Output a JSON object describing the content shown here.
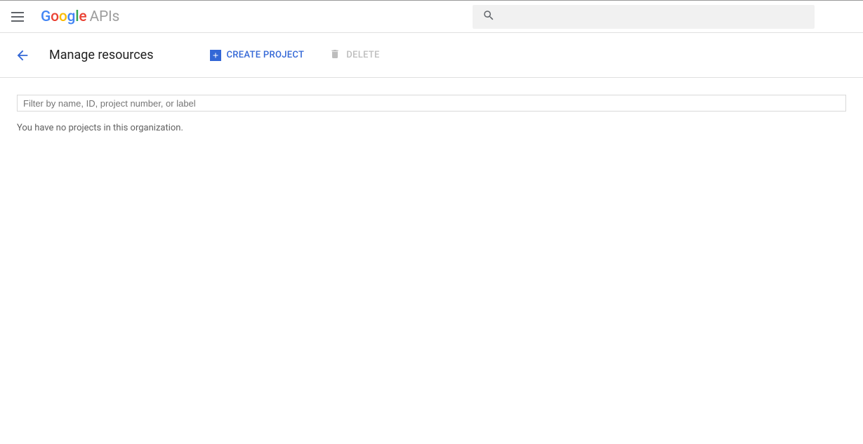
{
  "header": {
    "logo_suffix": "APIs",
    "search_placeholder": ""
  },
  "actionbar": {
    "title": "Manage resources",
    "create_label": "Create Project",
    "delete_label": "Delete"
  },
  "content": {
    "filter_placeholder": "Filter by name, ID, project number, or label",
    "empty_message": "You have no projects in this organization."
  }
}
